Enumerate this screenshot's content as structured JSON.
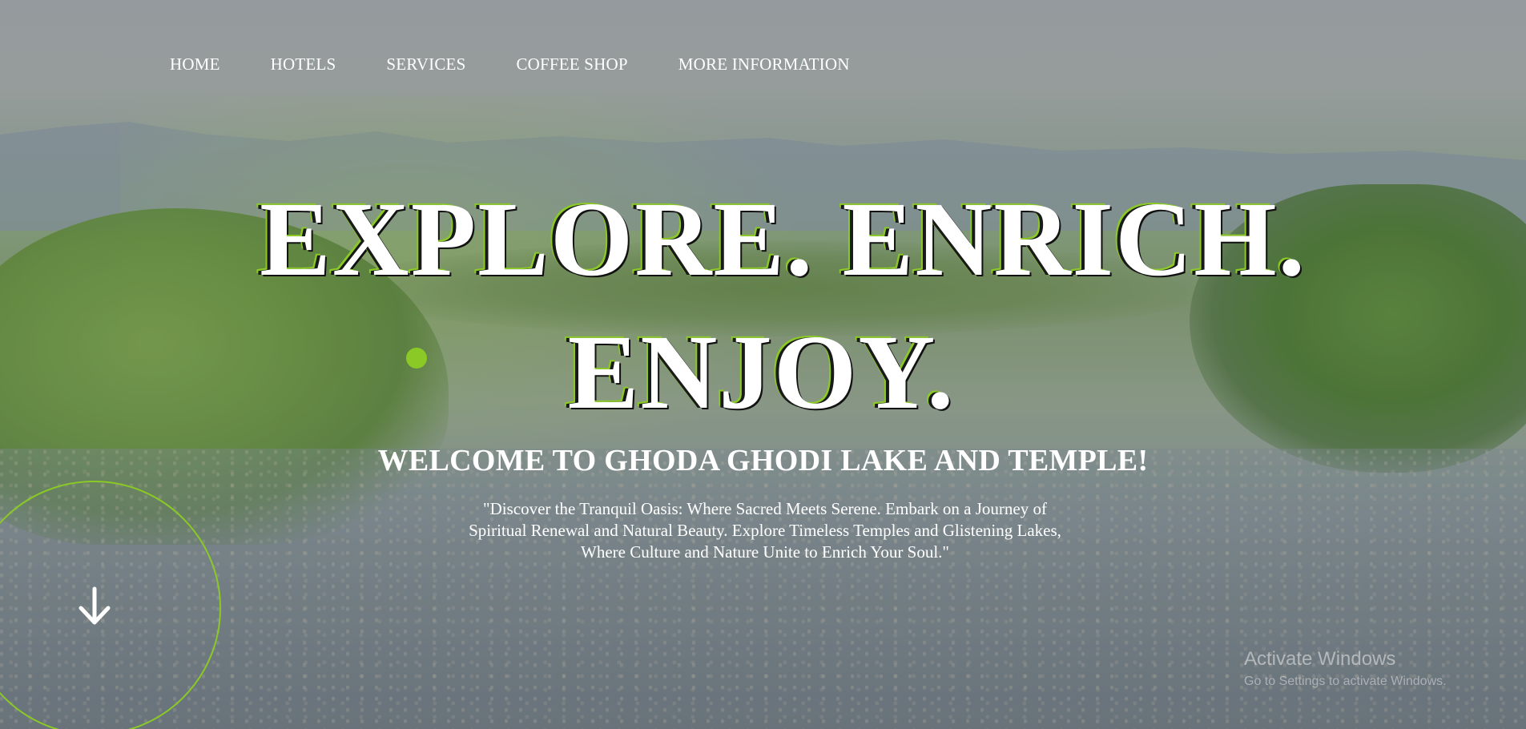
{
  "nav": {
    "items": [
      {
        "label": "HOME"
      },
      {
        "label": "HOTELS"
      },
      {
        "label": "SERVICES"
      },
      {
        "label": "COFFEE SHOP"
      },
      {
        "label": "MORE INFORMATION"
      }
    ]
  },
  "hero": {
    "headline_line1": "EXPLORE. ENRICH.",
    "headline_line2": "ENJOY.",
    "welcome": "WELCOME TO GHODA GHODI LAKE AND TEMPLE!",
    "tagline": "\"Discover the Tranquil Oasis: Where Sacred Meets Serene. Embark on a Journey of Spiritual Renewal and Natural Beauty. Explore Timeless Temples and Glistening Lakes, Where Culture and Nature Unite to Enrich Your Soul.\"",
    "scroll_icon": "arrow-down-icon"
  },
  "watermark": {
    "title": "Activate Windows",
    "subtitle": "Go to Settings to activate Windows."
  },
  "colors": {
    "accent": "#8ac926",
    "text": "#ffffff"
  }
}
